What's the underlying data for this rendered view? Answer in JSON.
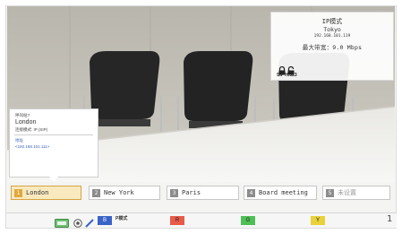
{
  "remote_info": {
    "mode": "IP模式",
    "city": "Tokyo",
    "ip": "192.168.101.119",
    "bandwidth": "最大带宽：9.0 Mbps",
    "protocol": "SIP H.323"
  },
  "site_popup": {
    "label": "呼叫站?:",
    "city": "London",
    "connection": "连接模式: IP (SIP)",
    "address_label": "地址",
    "address": "<192.168.101.111>"
  },
  "speed_dial": [
    {
      "num": "1",
      "label": "London",
      "selected": true
    },
    {
      "num": "2",
      "label": "New York",
      "selected": false
    },
    {
      "num": "3",
      "label": "Paris",
      "selected": false
    },
    {
      "num": "4",
      "label": "Board meeting",
      "selected": false
    },
    {
      "num": "5",
      "label": "未设置",
      "selected": false
    }
  ],
  "status_bar": {
    "mode_label": "P模式",
    "keys": [
      {
        "name": "B",
        "color": "#3a63c8"
      },
      {
        "name": "R",
        "color": "#e85a4a"
      },
      {
        "name": "G",
        "color": "#4fbf55"
      },
      {
        "name": "Y",
        "color": "#e8d13a"
      }
    ],
    "page_indicator": "1"
  },
  "colors": {
    "selected_fill": "#f8e9bf",
    "selected_border": "#d9a442",
    "link_blue": "#3a63b8"
  }
}
